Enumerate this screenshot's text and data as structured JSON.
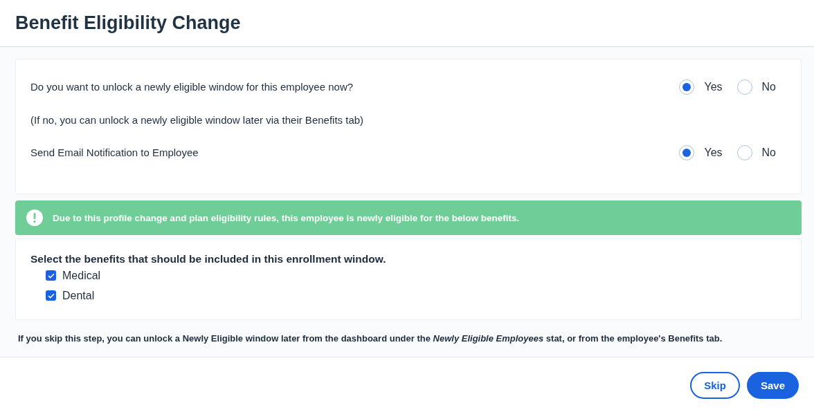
{
  "title": "Benefit Eligibility Change",
  "questions": [
    {
      "label": "Do you want to unlock a newly eligible window for this employee now?",
      "options": [
        {
          "label": "Yes",
          "selected": true
        },
        {
          "label": "No",
          "selected": false
        }
      ]
    },
    {
      "kind": "note",
      "label": "(If no, you can unlock a newly eligible window later via their Benefits tab)"
    },
    {
      "label": "Send Email Notification to Employee",
      "options": [
        {
          "label": "Yes",
          "selected": true
        },
        {
          "label": "No",
          "selected": false
        }
      ]
    }
  ],
  "banner": {
    "text": "Due to this profile change and plan eligibility rules, this employee is newly eligible for the below benefits."
  },
  "benefits": {
    "heading": "Select the benefits that should be included in this enrollment window.",
    "items": [
      {
        "label": "Medical",
        "checked": true
      },
      {
        "label": "Dental",
        "checked": true
      }
    ]
  },
  "footnote": "If you skip this step, you can unlock a Newly Eligible window later from the dashboard under the *Newly Eligible Employees* stat, or from the employee's Benefits tab.",
  "buttons": [
    {
      "label": "Skip",
      "kind": "secondary"
    },
    {
      "label": "Save",
      "kind": "primary"
    }
  ]
}
